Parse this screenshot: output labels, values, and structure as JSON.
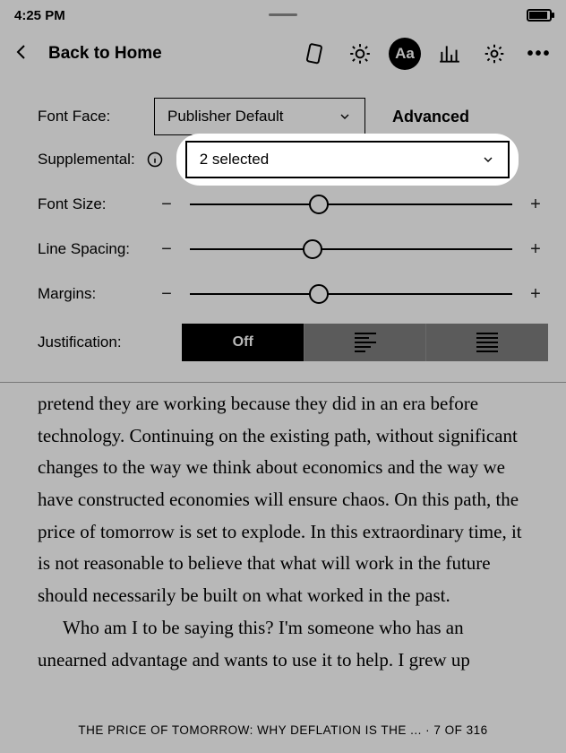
{
  "statusbar": {
    "time": "4:25 PM"
  },
  "toolbar": {
    "back_label": "Back to Home"
  },
  "settings": {
    "font_face_label": "Font Face:",
    "font_face_value": "Publisher Default",
    "advanced_label": "Advanced",
    "supplemental_label": "Supplemental:",
    "supplemental_value": "2 selected",
    "font_size_label": "Font Size:",
    "line_spacing_label": "Line Spacing:",
    "margins_label": "Margins:",
    "justification_label": "Justification:",
    "justification_off_label": "Off",
    "minus_sign": "−",
    "plus_sign": "+",
    "slider_positions": {
      "font_size_pct": 40,
      "line_spacing_pct": 38,
      "margins_pct": 40
    }
  },
  "content": {
    "paragraph1": "pretend they are working because they did in an era before technology. Continuing on the existing path, without significant changes to the way we think about economics and the way we have constructed economies will ensure chaos. On this path, the price of tomorrow is set to explode. In this extraordinary time, it is not reasonable to believe that what will work in the future should necessarily be built on what worked in the past.",
    "paragraph2": "Who am I to be saying this? I'm someone who has an unearned advantage and wants to use it to help. I grew up"
  },
  "footer": {
    "title_fragment": "THE PRICE OF TOMORROW: WHY DEFLATION IS THE ...",
    "separator": " · ",
    "page_location": "7 OF 316"
  }
}
